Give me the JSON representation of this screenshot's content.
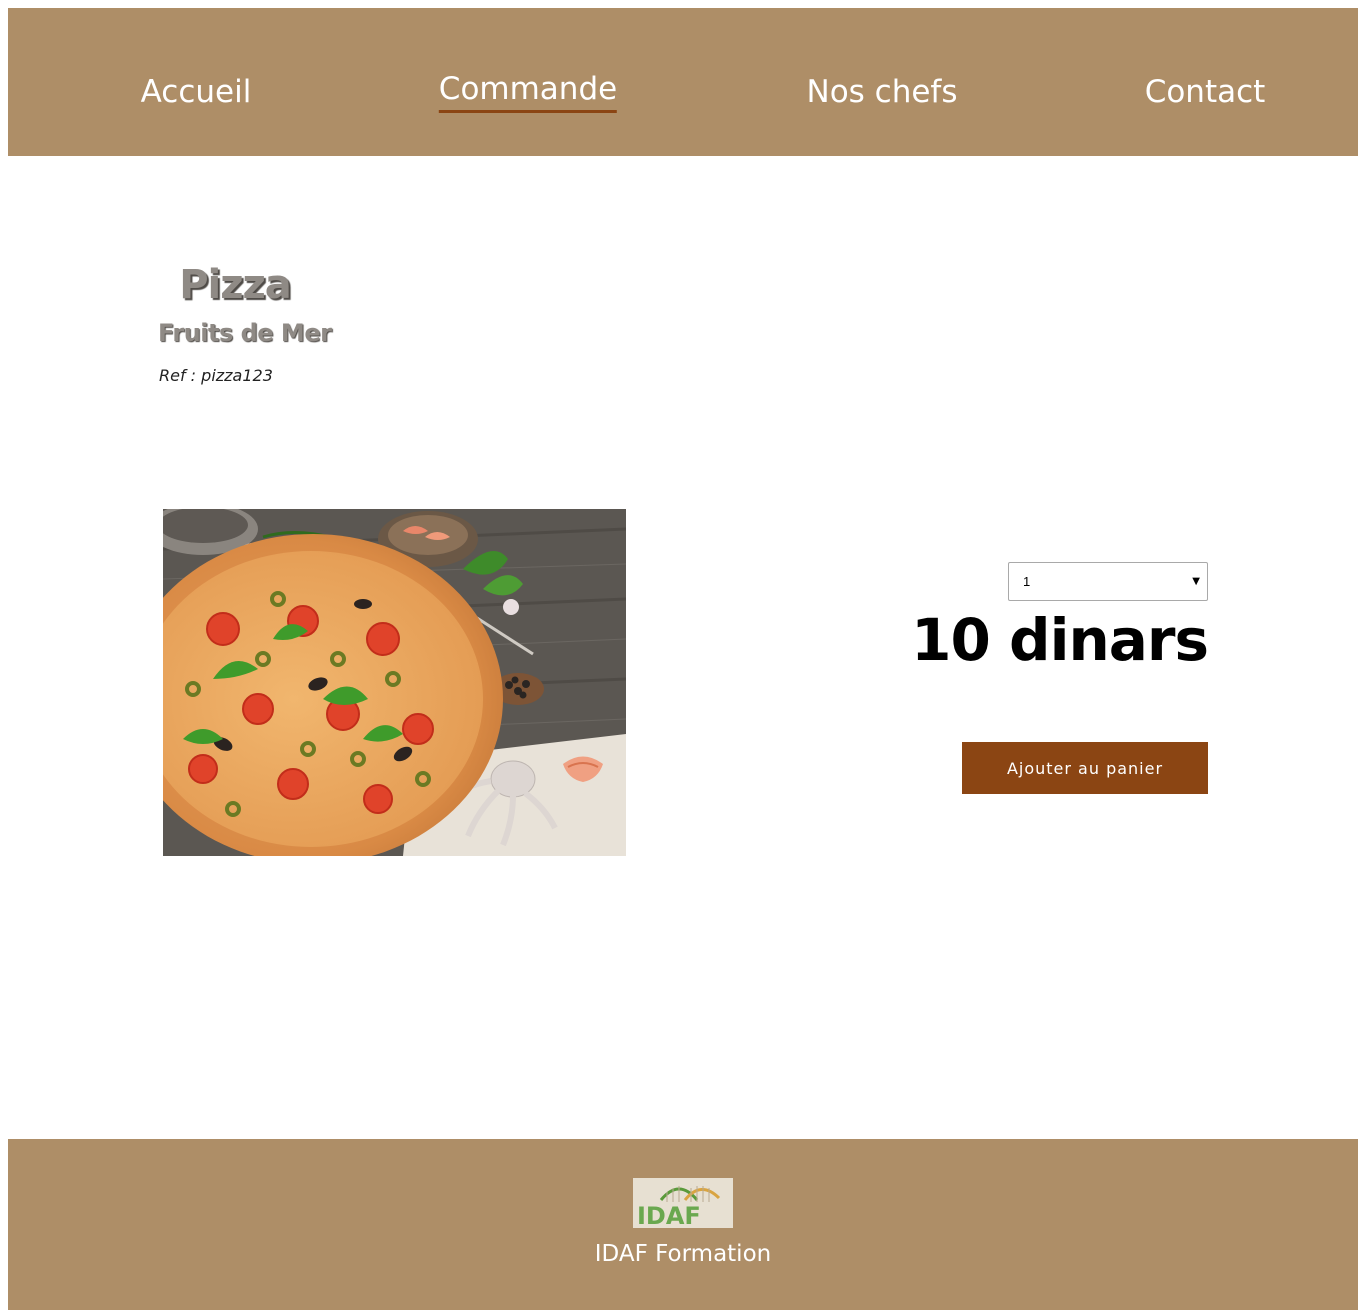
{
  "nav": {
    "items": [
      {
        "label": "Accueil"
      },
      {
        "label": "Commande",
        "active": true
      },
      {
        "label": "Nos chefs"
      },
      {
        "label": "Contact"
      }
    ]
  },
  "product": {
    "name": "Pizza",
    "variant": "Fruits de Mer",
    "ref": "Ref : pizza123",
    "image": "pizza-fruits-de-mer-photo",
    "quantity": "1",
    "price": "10 dinars",
    "add_to_cart_label": "Ajouter au panier"
  },
  "footer": {
    "logo_text": "IDAF",
    "text": "IDAF Formation"
  },
  "colors": {
    "header_bg": "#ae8e67",
    "accent": "#8b4513",
    "title_gray": "#8f8a85"
  }
}
